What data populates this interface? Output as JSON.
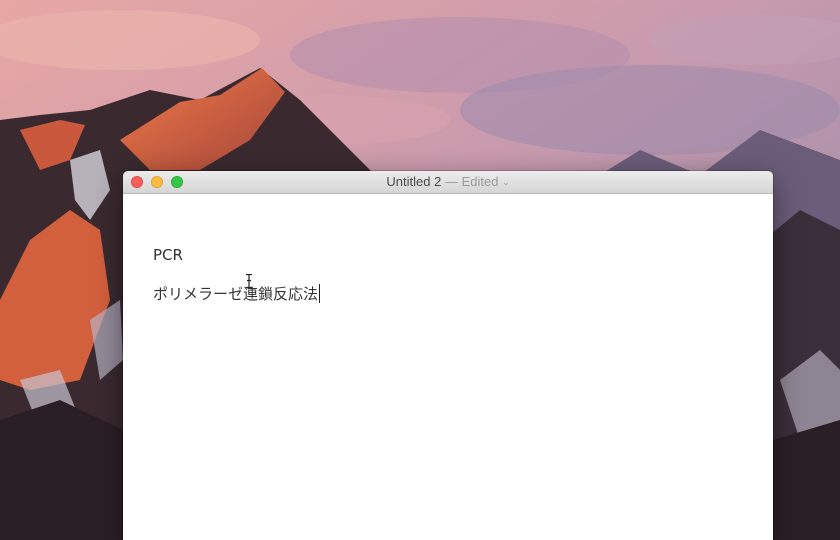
{
  "desktop": {
    "wallpaper": "macOS Sierra mountain",
    "sky_colors": [
      "#e7a8a6",
      "#b796b4",
      "#8f88a8"
    ],
    "mountain_colors": [
      "#e0693f",
      "#5a3b3e",
      "#30232a"
    ]
  },
  "window": {
    "title": "Untitled 2",
    "title_separator": "—",
    "status": "Edited",
    "status_chevron": "⌄",
    "traffic_lights": {
      "close": "#fc605c",
      "minimize": "#fdbc40",
      "zoom": "#34c84a"
    }
  },
  "document": {
    "lines": [
      "PCR",
      "ポリメラーゼ連鎖反応法"
    ]
  }
}
